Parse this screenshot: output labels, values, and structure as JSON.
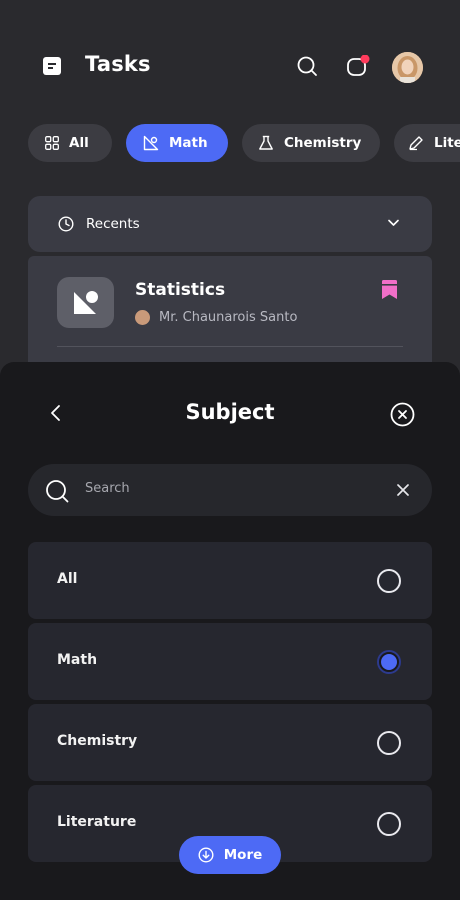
{
  "header": {
    "title": "Tasks"
  },
  "chips": [
    {
      "label": "All",
      "icon": "grid-icon",
      "active": false
    },
    {
      "label": "Math",
      "icon": "geometry-icon",
      "active": true
    },
    {
      "label": "Chemistry",
      "icon": "flask-icon",
      "active": false
    },
    {
      "label": "Literature",
      "icon": "pen-icon",
      "active": false
    }
  ],
  "recents": {
    "label": "Recents"
  },
  "card": {
    "title": "Statistics",
    "teacher": "Mr. Chaunarois Santo"
  },
  "sheet": {
    "title": "Subject",
    "search": {
      "placeholder": "Search"
    },
    "options": [
      {
        "label": "All",
        "selected": false
      },
      {
        "label": "Math",
        "selected": true
      },
      {
        "label": "Chemistry",
        "selected": false
      },
      {
        "label": "Literature",
        "selected": false
      }
    ],
    "more_label": "More"
  },
  "colors": {
    "accent": "#4d6af5",
    "bookmark": "#f06fc8",
    "notification": "#ff3b5c",
    "sheet_bg": "#19191c"
  }
}
